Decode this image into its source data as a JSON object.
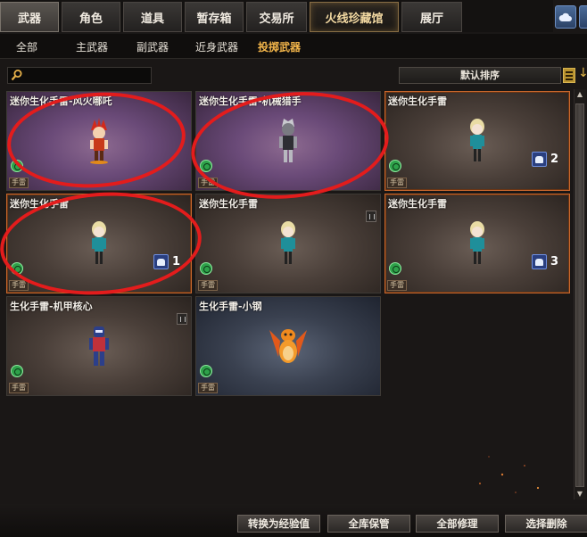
{
  "top_tabs": [
    "武器",
    "角色",
    "道具",
    "暂存箱",
    "交易所",
    "火线珍藏馆",
    "展厅"
  ],
  "sub_tabs": [
    "全部",
    "主武器",
    "副武器",
    "近身武器",
    "投掷武器"
  ],
  "search": {
    "placeholder": ""
  },
  "sort": {
    "label": "默认排序"
  },
  "items": [
    {
      "title": "迷你生化手雷-风火哪吒",
      "type": "手雷",
      "count": "",
      "style": "purple",
      "figure": "nezha"
    },
    {
      "title": "迷你生化手雷-机械猎手",
      "type": "手雷",
      "count": "",
      "style": "purple",
      "figure": "robot"
    },
    {
      "title": "迷你生化手雷",
      "type": "手雷",
      "count": "2",
      "style": "orange",
      "figure": "doll"
    },
    {
      "title": "迷你生化手雷",
      "type": "手雷",
      "count": "1",
      "style": "orange",
      "figure": "doll"
    },
    {
      "title": "迷你生化手雷",
      "type": "手雷",
      "count": "",
      "style": "plain",
      "figure": "doll"
    },
    {
      "title": "迷你生化手雷",
      "type": "手雷",
      "count": "3",
      "style": "orange",
      "figure": "doll"
    },
    {
      "title": "生化手雷-机甲核心",
      "type": "手雷",
      "count": "",
      "style": "plain",
      "figure": "mech"
    },
    {
      "title": "生化手雷-小钢",
      "type": "手雷",
      "count": "",
      "style": "blue",
      "figure": "dragon"
    }
  ],
  "buttons": {
    "convert": "转换为经验值",
    "store_all": "全库保管",
    "repair_all": "全部修理",
    "select_delete": "选择删除"
  },
  "colors": {
    "highlight_ring": "#e31c1c",
    "active_subtab": "#f2b54a",
    "card_orange_border": "#c9682d"
  }
}
